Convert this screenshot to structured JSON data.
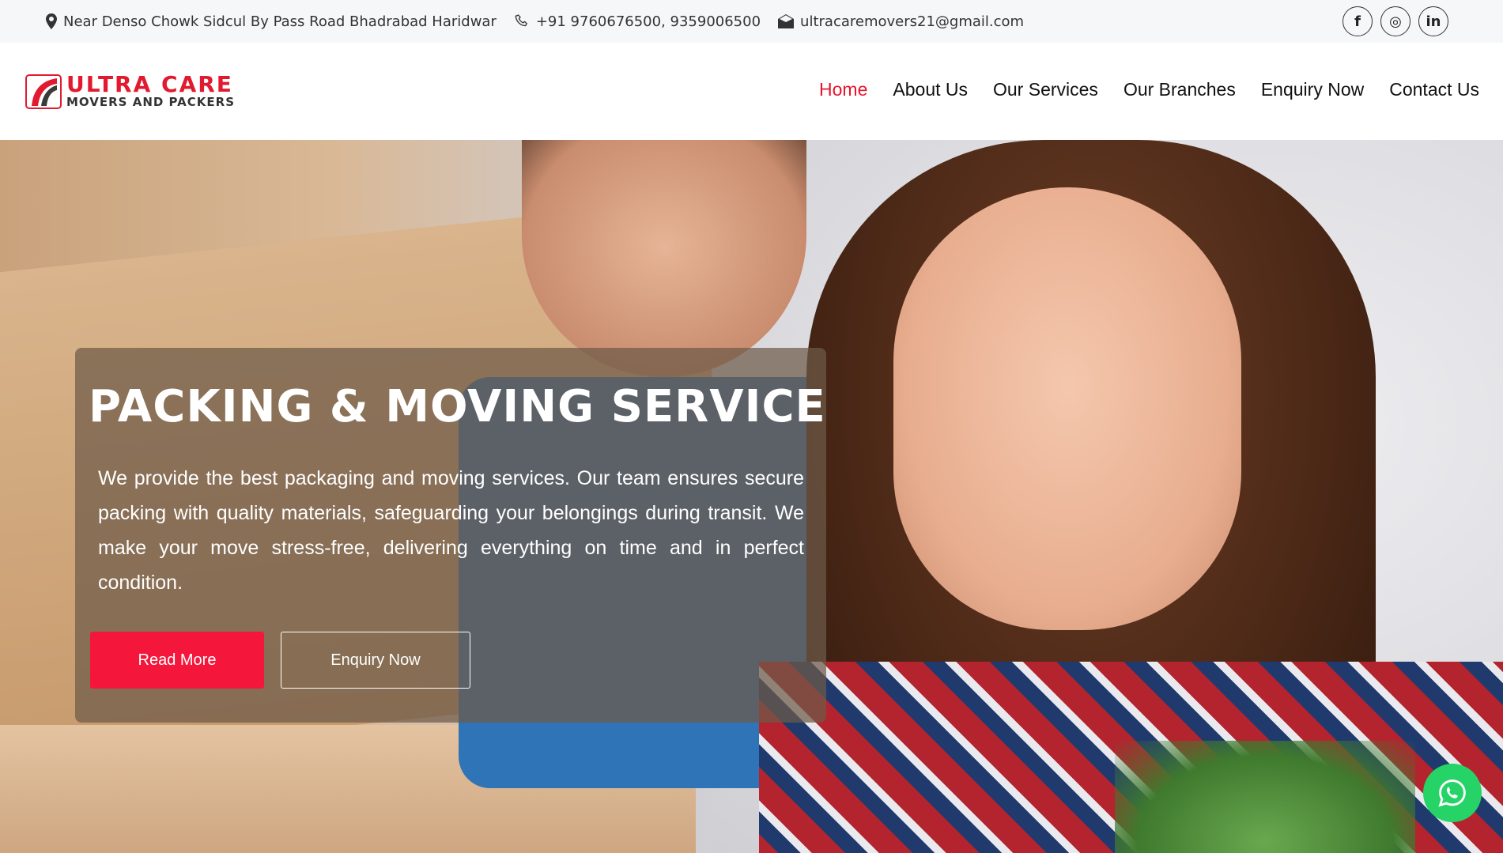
{
  "topbar": {
    "address": "Near Denso Chowk Sidcul By Pass Road Bhadrabad Haridwar",
    "phone": "+91 9760676500, 9359006500",
    "email": "ultracaremovers21@gmail.com",
    "socials": [
      {
        "icon": "facebook-icon",
        "glyph": "f"
      },
      {
        "icon": "instagram-icon",
        "glyph": "◎"
      },
      {
        "icon": "linkedin-icon",
        "glyph": "in"
      }
    ]
  },
  "logo": {
    "line1": "ULTRA CARE",
    "line2": "MOVERS AND PACKERS"
  },
  "nav": {
    "items": [
      {
        "label": "Home",
        "active": true
      },
      {
        "label": "About Us"
      },
      {
        "label": "Our Services"
      },
      {
        "label": "Our Branches"
      },
      {
        "label": "Enquiry Now"
      },
      {
        "label": "Contact Us"
      }
    ]
  },
  "hero": {
    "title": "PACKING & MOVING SERVICE",
    "text": "We provide the best packaging and moving services. Our team ensures secure packing with quality materials, safeguarding your belongings during transit. We make your move stress-free, delivering everything on time and in perfect condition.",
    "read_more": "Read More",
    "enquiry": "Enquiry Now"
  },
  "colors": {
    "accent": "#f5173b",
    "nav_active": "#e8132f",
    "whatsapp": "#25d366"
  }
}
